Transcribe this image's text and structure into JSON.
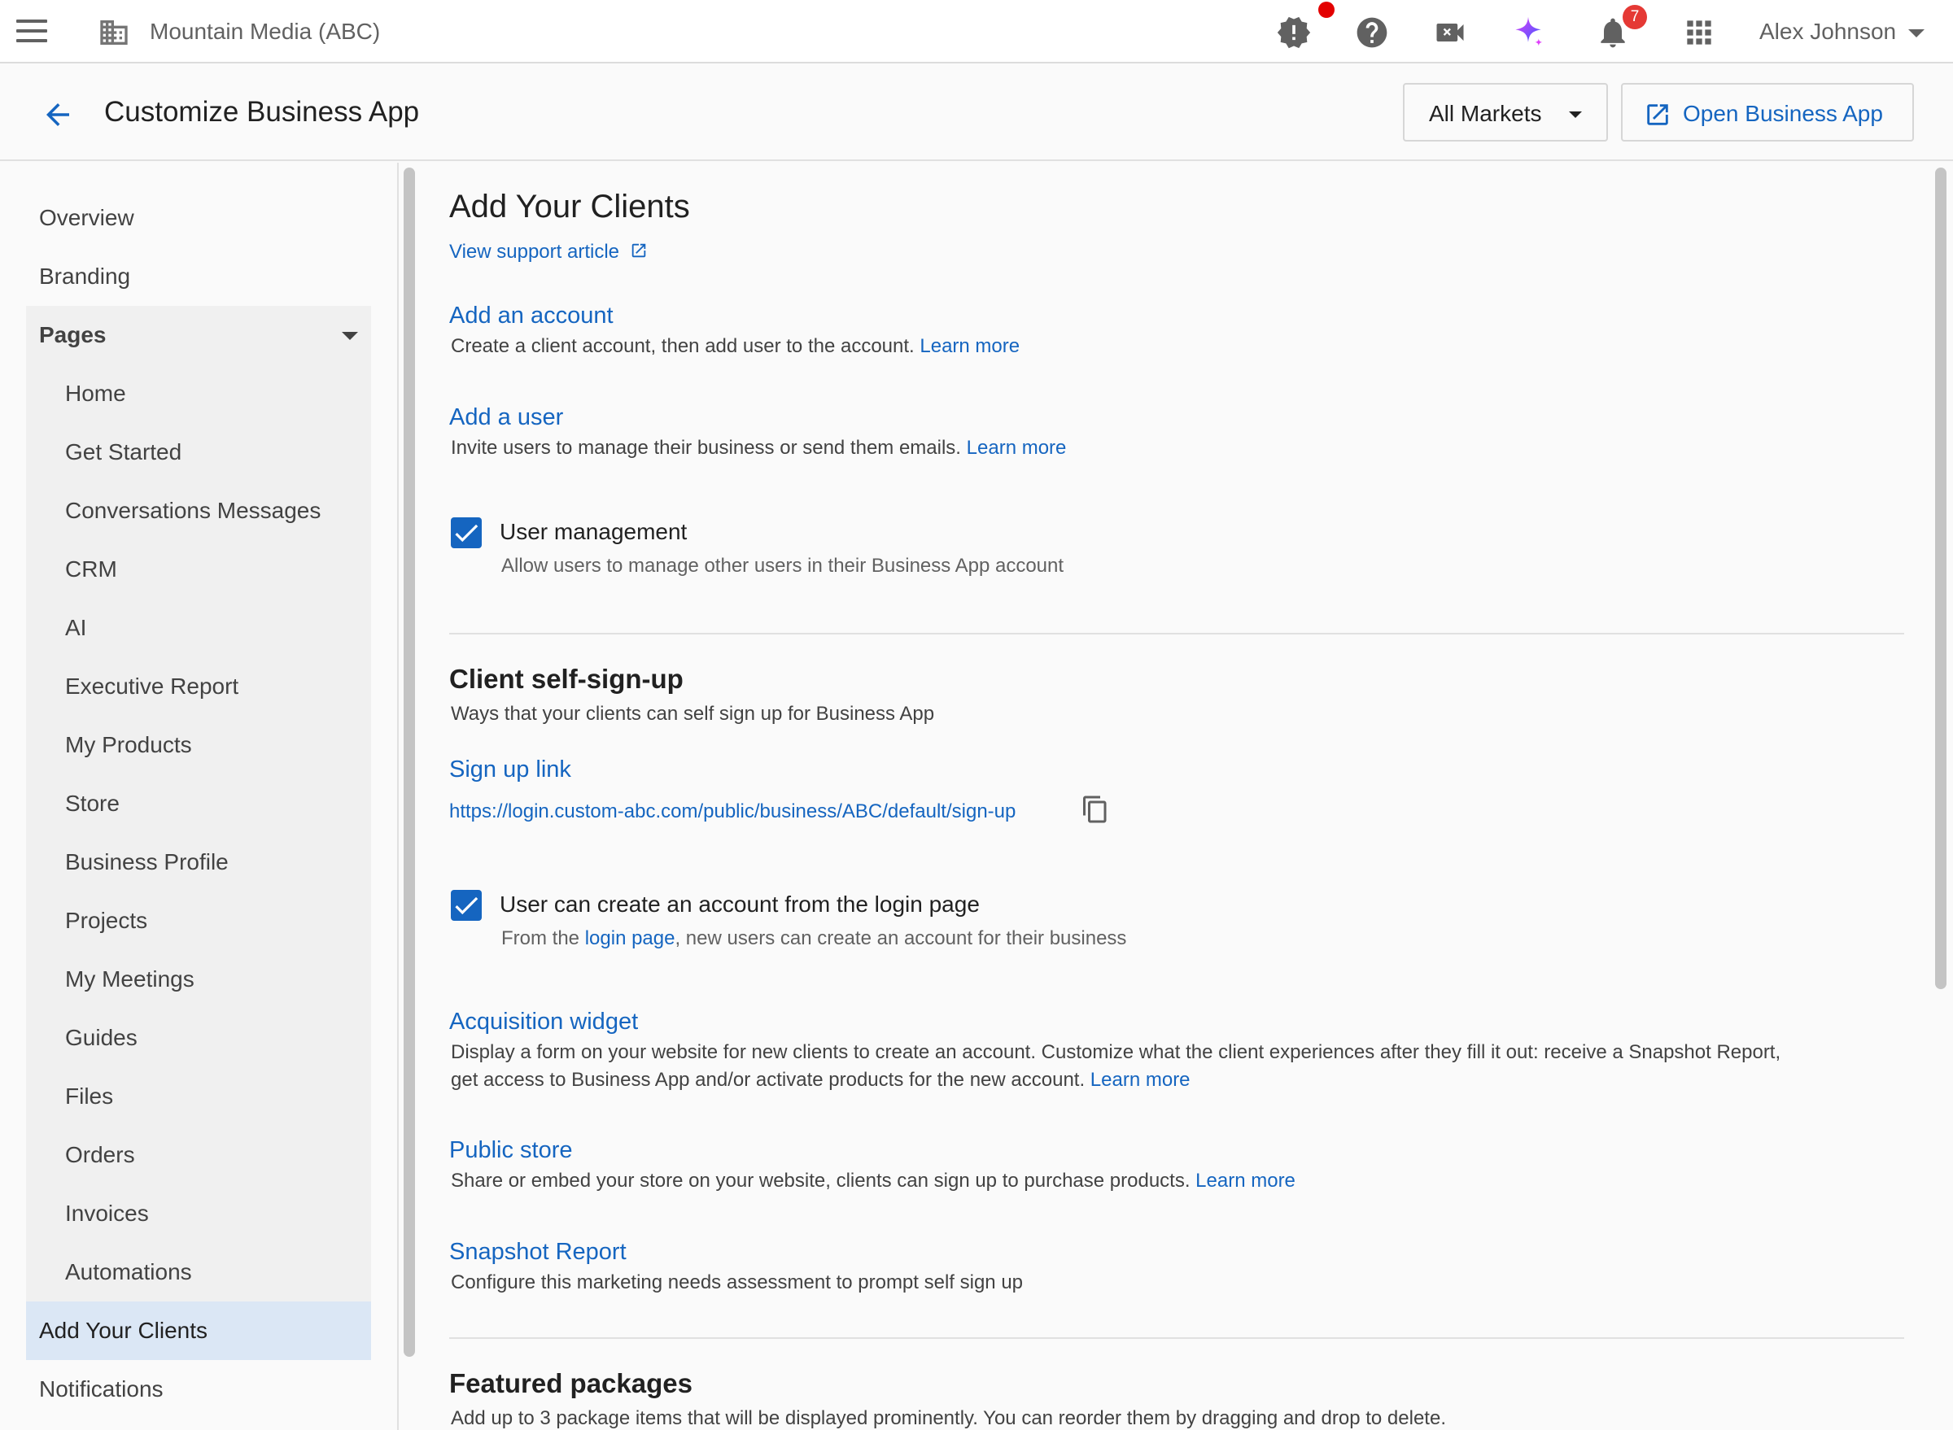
{
  "topbar": {
    "org_name": "Mountain Media (ABC)",
    "notification_count": "7",
    "user_name": "Alex Johnson",
    "icons": [
      "menu-icon",
      "building-icon",
      "alert-icon",
      "help-icon",
      "video-icon",
      "sparkle-icon",
      "bell-icon",
      "apps-grid-icon"
    ]
  },
  "header": {
    "title": "Customize Business App",
    "markets_label": "All Markets",
    "open_label": "Open Business App"
  },
  "sidebar": {
    "items": [
      {
        "label": "Overview"
      },
      {
        "label": "Branding"
      },
      {
        "label": "Pages"
      },
      {
        "label": "Home"
      },
      {
        "label": "Get Started"
      },
      {
        "label": "Conversations Messages"
      },
      {
        "label": "CRM"
      },
      {
        "label": "AI"
      },
      {
        "label": "Executive Report"
      },
      {
        "label": "My Products"
      },
      {
        "label": "Store"
      },
      {
        "label": "Business Profile"
      },
      {
        "label": "Projects"
      },
      {
        "label": "My Meetings"
      },
      {
        "label": "Guides"
      },
      {
        "label": "Files"
      },
      {
        "label": "Orders"
      },
      {
        "label": "Invoices"
      },
      {
        "label": "Automations"
      },
      {
        "label": "Add Your Clients"
      },
      {
        "label": "Notifications"
      }
    ]
  },
  "main": {
    "title": "Add Your Clients",
    "support_link": "View support article",
    "learn_more": "Learn more",
    "add_account": {
      "title": "Add an account",
      "desc": "Create a client account, then add user to the account."
    },
    "add_user": {
      "title": "Add a user",
      "desc": "Invite users to manage their business or send them emails."
    },
    "user_management": {
      "label": "User management",
      "desc": "Allow users to manage other users in their Business App account",
      "checked": true
    },
    "self_signup": {
      "title": "Client self-sign-up",
      "desc": "Ways that your clients can self sign up for Business App",
      "signup_link_title": "Sign up link",
      "signup_url": "https://login.custom-abc.com/public/business/ABC/default/sign-up",
      "create_account": {
        "label": "User can create an account from the login page",
        "desc_prefix": "From the",
        "desc_link": "login page",
        "desc_suffix": ", new users can create an account for their business",
        "checked": true
      },
      "acquisition": {
        "title": "Acquisition widget",
        "desc_line1": "Display a form on your website for new clients to create an account. Customize what the client experiences after they fill it out: receive a Snapshot Report,",
        "desc_line2": "get access to Business App and/or activate products for the new account."
      },
      "public_store": {
        "title": "Public store",
        "desc": "Share or embed your store on your website, clients can sign up to purchase products."
      },
      "snapshot": {
        "title": "Snapshot Report",
        "desc": "Configure this marketing needs assessment to prompt self sign up"
      }
    },
    "featured": {
      "title": "Featured packages",
      "desc": "Add up to 3 package items that will be displayed prominently. You can reorder them by dragging and drop to delete."
    }
  },
  "colors": {
    "accent": "#1565c0",
    "active_nav": "#dbe7f5",
    "badge": "#e53935"
  }
}
